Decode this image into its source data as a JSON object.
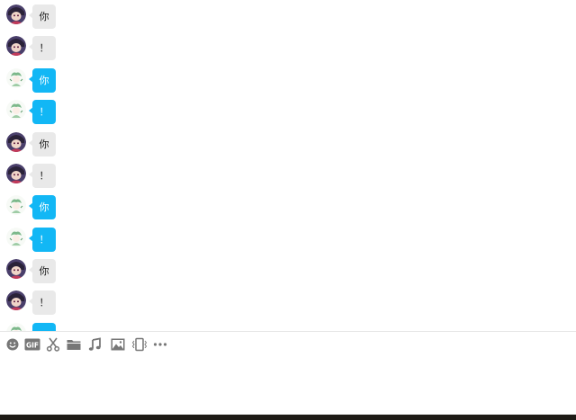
{
  "messages": [
    {
      "sender": "other",
      "text": "你"
    },
    {
      "sender": "other",
      "text": "！"
    },
    {
      "sender": "self",
      "text": "你"
    },
    {
      "sender": "self",
      "text": "！"
    },
    {
      "sender": "other",
      "text": "你"
    },
    {
      "sender": "other",
      "text": "！"
    },
    {
      "sender": "self",
      "text": "你"
    },
    {
      "sender": "self",
      "text": "！"
    },
    {
      "sender": "other",
      "text": "你"
    },
    {
      "sender": "other",
      "text": "！"
    },
    {
      "sender": "self",
      "text": ""
    }
  ],
  "toolbar": {
    "items": [
      {
        "name": "emoji-icon"
      },
      {
        "name": "gif-icon",
        "label": "GIF"
      },
      {
        "name": "screenshot-scissors-icon"
      },
      {
        "name": "folder-icon"
      },
      {
        "name": "music-icon"
      },
      {
        "name": "image-icon"
      },
      {
        "name": "shake-window-icon"
      },
      {
        "name": "more-icon"
      }
    ]
  },
  "colors": {
    "self_bubble": "#12b7f5",
    "other_bubble": "#e9e9e9",
    "toolbar_icon": "#777777"
  }
}
